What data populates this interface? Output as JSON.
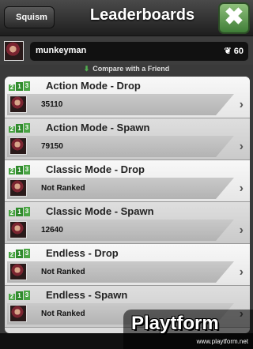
{
  "header": {
    "back_label": "Squism",
    "title": "Leaderboards",
    "close_glyph": "✖"
  },
  "user": {
    "name": "munkeyman",
    "score_icon": "leaf-icon",
    "score": "60"
  },
  "compare": {
    "label": "Compare with a Friend"
  },
  "entries": [
    {
      "title": "Action Mode - Drop",
      "value": "35110"
    },
    {
      "title": "Action Mode - Spawn",
      "value": "79150"
    },
    {
      "title": "Classic Mode - Drop",
      "value": "Not Ranked"
    },
    {
      "title": "Classic Mode - Spawn",
      "value": "12640"
    },
    {
      "title": "Endless - Drop",
      "value": "Not Ranked"
    },
    {
      "title": "Endless - Spawn",
      "value": "Not Ranked"
    }
  ],
  "watermark": {
    "logo": "Playtform",
    "url": "www.playtform.net"
  },
  "colors": {
    "accent_green": "#4aa444",
    "header_dark": "#1e1e1e",
    "list_bg": "#dddddd"
  }
}
